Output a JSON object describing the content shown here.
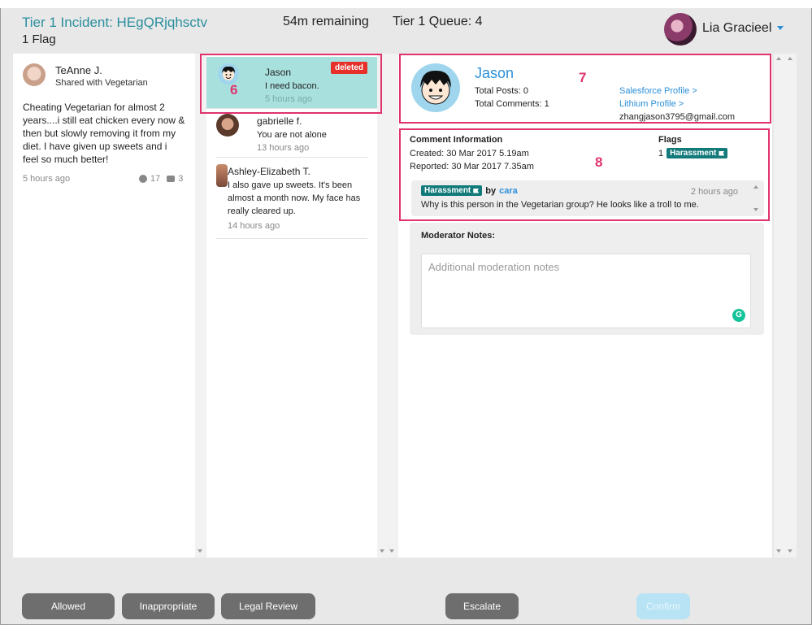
{
  "header": {
    "incident_title": "Tier 1 Incident: HEgQRjqhsctv",
    "flag_count": "1 Flag",
    "time_remaining": "54m remaining",
    "queue": "Tier 1 Queue: 4",
    "user_name": "Lia Gracieel"
  },
  "post": {
    "author": "TeAnne J.",
    "shared": "Shared with Vegetarian",
    "body": "Cheating Vegetarian for almost 2 years....i still eat chicken every now & then but slowly removing it from my diet. I have given up sweets and i feel so much better!",
    "time": "5 hours ago",
    "likes": "17",
    "comments": "3"
  },
  "comments": [
    {
      "name": "Jason",
      "text": "I need bacon.",
      "time": "5 hours ago",
      "badge": "deleted"
    },
    {
      "name": "gabrielle f.",
      "text": "You are not alone",
      "time": "13 hours ago"
    },
    {
      "name": "Ashley-Elizabeth T.",
      "text": "I also gave up sweets. It's been almost a month now. My face has really cleared up.",
      "time": "14 hours ago"
    }
  ],
  "profile": {
    "name": "Jason",
    "total_posts": "Total Posts: 0",
    "total_comments": "Total Comments: 1",
    "salesforce_link": "Salesforce Profile >",
    "lithium_link": "Lithium Profile >",
    "email": "zhangjason3795@gmail.com"
  },
  "comment_info": {
    "title": "Comment Information",
    "created": "Created:   30 Mar 2017 5.19am",
    "reported": "Reported: 30 Mar 2017 7.35am",
    "flags_title": "Flags",
    "flags_count": "1",
    "flag_tag": "Harassment"
  },
  "flag_detail": {
    "tag": "Harassment",
    "by": "by",
    "user": "cara",
    "time": "2 hours ago",
    "text": "Why is this person in the Vegetarian group? He looks like a troll to me."
  },
  "notes": {
    "label": "Moderator Notes:",
    "placeholder": "Additional moderation notes",
    "value": ""
  },
  "annotations": [
    "6",
    "7",
    "8"
  ],
  "buttons": {
    "allowed": "Allowed",
    "inappropriate": "Inappropriate",
    "legal_review": "Legal Review",
    "escalate": "Escalate",
    "confirm": "Confirm"
  },
  "colors": {
    "accent": "#2b8fd9",
    "teal_title": "#2b8f9e",
    "selected_row": "#a8e0de",
    "deleted": "#e8302b",
    "tag": "#127a7a",
    "annotation": "#e0326f",
    "button": "#6e6e6e",
    "button_disabled": "#b8e3f5"
  }
}
